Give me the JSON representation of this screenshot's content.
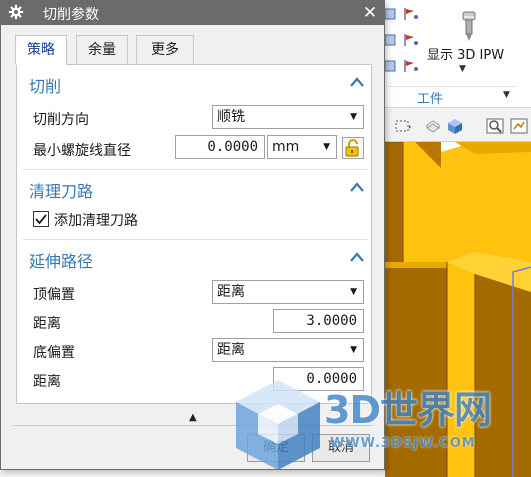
{
  "dialog": {
    "title": "切削参数",
    "close_glyph": "✕",
    "tabs": [
      {
        "label": "策略",
        "active": true
      },
      {
        "label": "余量",
        "active": false
      },
      {
        "label": "更多",
        "active": false
      }
    ],
    "sections": {
      "cutting": {
        "title": "切削",
        "cut_direction_label": "切削方向",
        "cut_direction_value": "顺铣",
        "min_helix_diameter_label": "最小螺旋线直径",
        "min_helix_diameter_value": "0.0000",
        "min_helix_diameter_unit": "mm"
      },
      "cleanup": {
        "title": "清理刀路",
        "add_cleanup_label": "添加清理刀路",
        "add_cleanup_checked": true
      },
      "extend_path": {
        "title": "延伸路径",
        "top_offset_label": "顶偏置",
        "top_offset_value": "距离",
        "top_distance_label": "距离",
        "top_distance_value": "3.0000",
        "bottom_offset_label": "底偏置",
        "bottom_offset_value": "距离",
        "bottom_distance_label": "距离",
        "bottom_distance_value": "0.0000"
      }
    },
    "buttons": {
      "ok": "确定",
      "cancel": "取消"
    }
  },
  "ribbon": {
    "show_ipw_label": "显示 3D IPW",
    "group_label": "工件"
  },
  "watermark": {
    "brand": "3D世界网",
    "url": "WWW.3DSJW.COM"
  },
  "colors": {
    "titlebar": "#6b6b6b",
    "section_title": "#3a78b5",
    "part_yellow": "#ffc20e",
    "part_brown": "#a36a00",
    "watermark_blue": "#3f86c8"
  },
  "icons": {
    "title": "gear-icon",
    "collapse": "chevron-up-icon",
    "lock": "padlock-icon",
    "dropdown": "caret-down-icon"
  }
}
